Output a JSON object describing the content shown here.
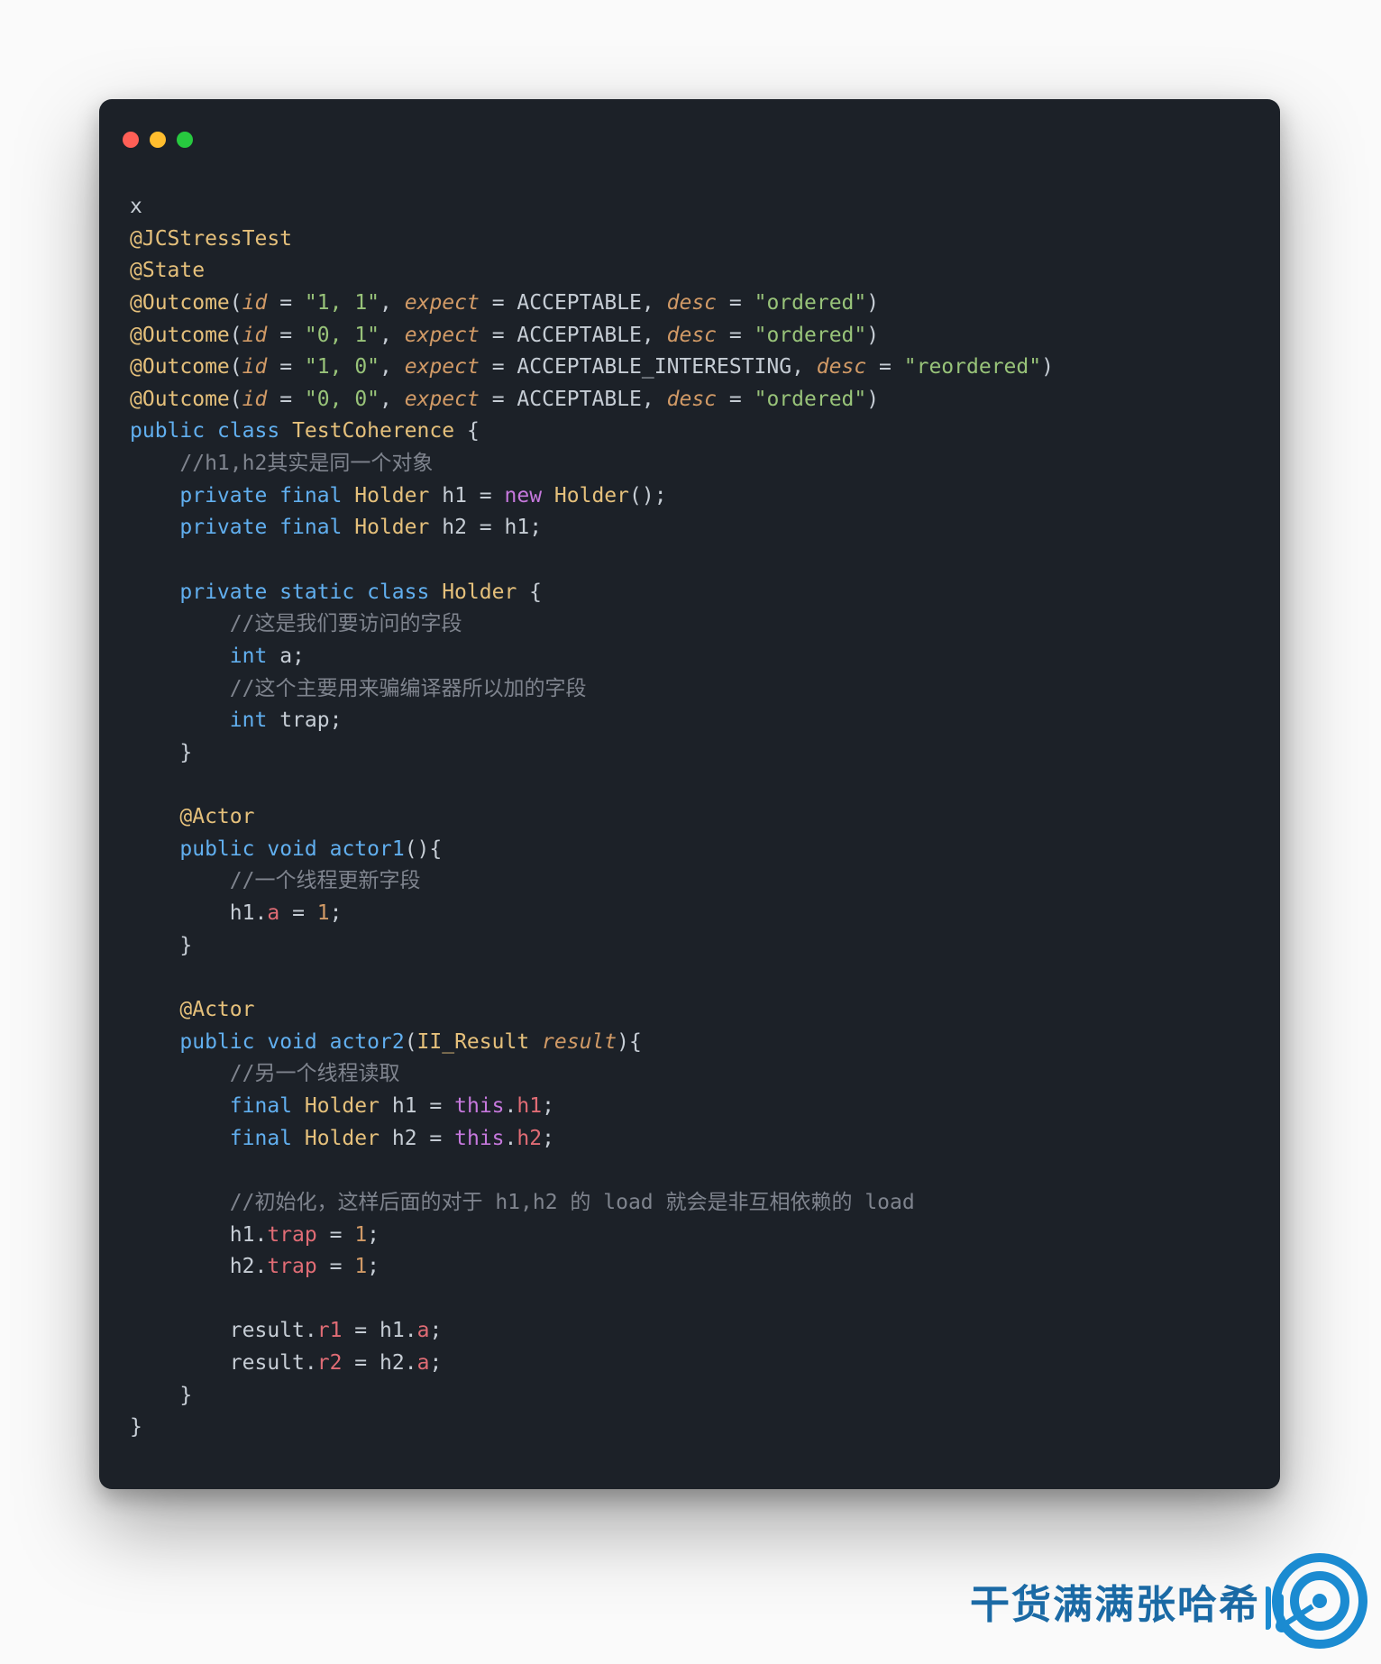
{
  "window": {
    "traffic_lights": [
      "close",
      "minimize",
      "zoom"
    ]
  },
  "code": {
    "header_x": "x",
    "ann_jcstress": "@JCStressTest",
    "ann_state": "@State",
    "outcomes": [
      {
        "id": "1, 1",
        "expect": "ACCEPTABLE",
        "desc": "ordered"
      },
      {
        "id": "0, 1",
        "expect": "ACCEPTABLE",
        "desc": "ordered"
      },
      {
        "id": "1, 0",
        "expect": "ACCEPTABLE_INTERESTING",
        "desc": "reordered"
      },
      {
        "id": "0, 0",
        "expect": "ACCEPTABLE",
        "desc": "ordered"
      }
    ],
    "class_decl": {
      "public": "public",
      "class": "class",
      "name": "TestCoherence"
    },
    "comment_same_obj": "//h1,h2其实是同一个对象",
    "field_h1": {
      "mods": "private final",
      "type": "Holder",
      "name": "h1",
      "init_new": "new",
      "init_type": "Holder"
    },
    "field_h2": {
      "mods": "private final",
      "type": "Holder",
      "name": "h2",
      "init": "h1"
    },
    "inner_class": {
      "mods": "private static class",
      "name": "Holder"
    },
    "comment_field_we_access": "//这是我们要访问的字段",
    "field_a": {
      "type": "int",
      "name": "a"
    },
    "comment_trap": "//这个主要用来骗编译器所以加的字段",
    "field_trap": {
      "type": "int",
      "name": "trap"
    },
    "ann_actor": "@Actor",
    "actor1": {
      "public": "public",
      "void": "void",
      "name": "actor1"
    },
    "comment_thread_update": "//一个线程更新字段",
    "actor1_body": {
      "lhs": "h1",
      "prop": "a",
      "val": "1"
    },
    "actor2": {
      "public": "public",
      "void": "void",
      "name": "actor2",
      "param_type": "II_Result",
      "param_name": "result"
    },
    "comment_other_thread_read": "//另一个线程读取",
    "actor2_h1": {
      "final": "final",
      "type": "Holder",
      "name": "h1",
      "this": "this",
      "prop": "h1"
    },
    "actor2_h2": {
      "final": "final",
      "type": "Holder",
      "name": "h2",
      "this": "this",
      "prop": "h2"
    },
    "comment_init_load": "//初始化，这样后面的对于 h1,h2 的 load 就会是非互相依赖的 load",
    "trap1": {
      "obj": "h1",
      "prop": "trap",
      "val": "1"
    },
    "trap2": {
      "obj": "h2",
      "prop": "trap",
      "val": "1"
    },
    "result1": {
      "obj": "result",
      "prop": "r1",
      "rhs_obj": "h1",
      "rhs_prop": "a"
    },
    "result2": {
      "obj": "result",
      "prop": "r2",
      "rhs_obj": "h2",
      "rhs_prop": "a"
    }
  },
  "watermark": {
    "text": "干货满满张哈希"
  }
}
